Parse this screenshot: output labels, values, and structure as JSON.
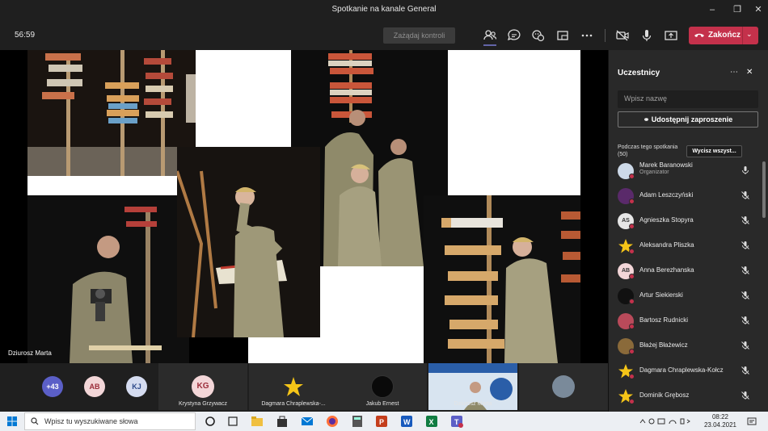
{
  "window": {
    "title": "Spotkanie na kanale General"
  },
  "meeting": {
    "timer": "56:59",
    "control_button": "Zażądaj kontroli",
    "hangup_label": "Zakończ",
    "toolbar_icons": [
      "people-icon",
      "chat-icon",
      "reactions-icon",
      "share-tray-icon",
      "more-icon",
      "camera-off-icon",
      "mic-icon",
      "share-screen-icon"
    ]
  },
  "stage": {
    "presenter_label": "Dziurosz Marta",
    "background": "#000000"
  },
  "strip": {
    "overflow_count": "+43",
    "bubbles": [
      {
        "initials": "AB",
        "color": "#f3d6d8"
      },
      {
        "initials": "KJ",
        "color": "#d5dcf0"
      }
    ],
    "tiles": [
      {
        "initials": "KG",
        "name": "Krystyna Grzywacz"
      },
      {
        "initials": "",
        "name": "Dagmara Chraplewska-..."
      },
      {
        "initials": "",
        "name": "Jakub Ernest"
      },
      {
        "initials": "",
        "name": "Dziurosz Marta"
      },
      {
        "initials": "",
        "name": ""
      }
    ]
  },
  "panel": {
    "title": "Uczestnicy",
    "search_placeholder": "Wpisz nazwę",
    "share_label": "Udostępnij zaproszenie",
    "section_label": "Podczas tego spotkania (50)",
    "mute_all_label": "Wycisz wszyst...",
    "participants": [
      {
        "name": "Marek Baranowski",
        "role": "Organizator",
        "initials": "",
        "avatar_color": "#cdd9e8",
        "muted": false
      },
      {
        "name": "Adam Leszczyński",
        "role": "",
        "initials": "",
        "avatar_color": "#5a2a6a",
        "muted": true
      },
      {
        "name": "Agnieszka Stopyra",
        "role": "",
        "initials": "AS",
        "avatar_color": "#e6e6e6",
        "muted": true
      },
      {
        "name": "Aleksandra Pliszka",
        "role": "",
        "initials": "",
        "avatar_color": "#f5c518",
        "muted": true
      },
      {
        "name": "Anna Berezhanska",
        "role": "",
        "initials": "AB",
        "avatar_color": "#f3d6d8",
        "muted": true
      },
      {
        "name": "Artur Siekierski",
        "role": "",
        "initials": "",
        "avatar_color": "#111111",
        "muted": true
      },
      {
        "name": "Bartosz Rudnicki",
        "role": "",
        "initials": "",
        "avatar_color": "#b94a5a",
        "muted": true
      },
      {
        "name": "Błażej Błażewicz",
        "role": "",
        "initials": "",
        "avatar_color": "#8a6a3a",
        "muted": true
      },
      {
        "name": "Dagmara Chraplewska-Kołcz",
        "role": "",
        "initials": "",
        "avatar_color": "#f5c518",
        "muted": true
      },
      {
        "name": "Dominik Grębosz",
        "role": "",
        "initials": "",
        "avatar_color": "#f5c518",
        "muted": true
      }
    ]
  },
  "taskbar": {
    "search_placeholder": "Wpisz tu wyszukiwane słowa",
    "time": "08:22",
    "date": "23.04.2021"
  },
  "colors": {
    "accent": "#6264a7",
    "hangup": "#c4314b",
    "panel_bg": "#292929",
    "app_bg": "#1f1f1f"
  }
}
